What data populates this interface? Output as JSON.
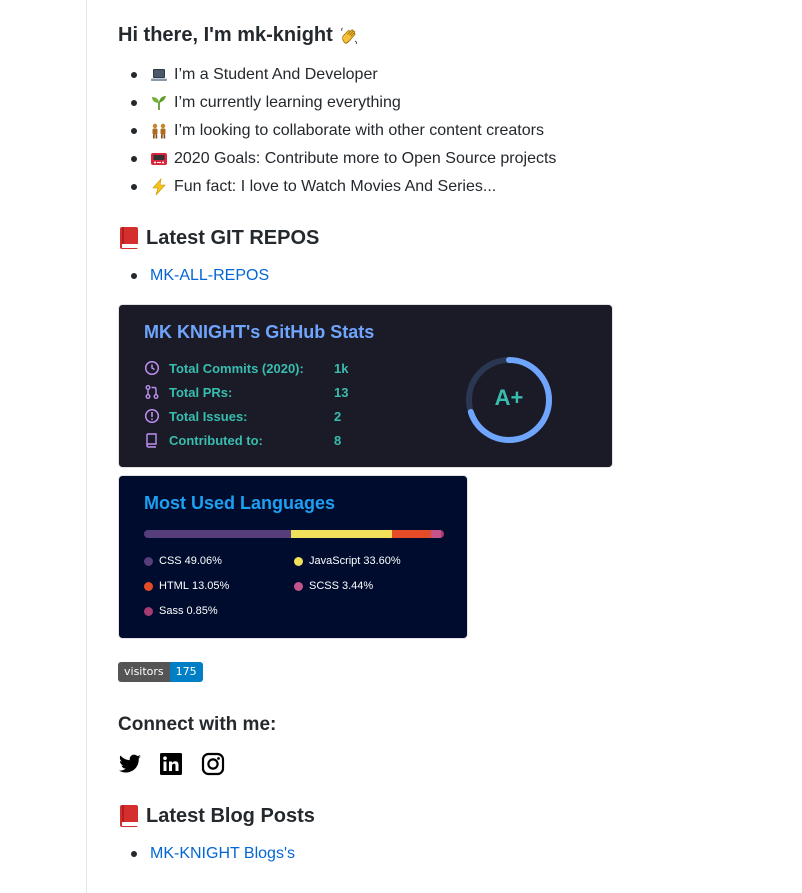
{
  "intro": {
    "heading": "Hi there, I'm mk-knight",
    "wave_icon": "waving-hand-icon",
    "bullets": [
      {
        "icon": "laptop-icon",
        "text": "I’m a Student And Developer"
      },
      {
        "icon": "seedling-icon",
        "text": "I’m currently learning everything"
      },
      {
        "icon": "people-icon",
        "text": "I’m looking to collaborate with other content creators"
      },
      {
        "icon": "game-console-icon",
        "text": "2020 Goals: Contribute more to Open Source projects"
      },
      {
        "icon": "lightning-icon",
        "text": "Fun fact: I love to Watch Movies And Series..."
      }
    ]
  },
  "repos": {
    "heading": "Latest GIT REPOS",
    "icon": "red-book-icon",
    "links": [
      "MK-ALL-REPOS"
    ]
  },
  "stats_card": {
    "title": "MK KNIGHT's GitHub Stats",
    "rows": [
      {
        "icon": "history-icon",
        "label": "Total Commits (2020):",
        "value": "1k"
      },
      {
        "icon": "pull-request-icon",
        "label": "Total PRs:",
        "value": "13"
      },
      {
        "icon": "issue-icon",
        "label": "Total Issues:",
        "value": "2"
      },
      {
        "icon": "repo-icon",
        "label": "Contributed to:",
        "value": "8"
      }
    ],
    "rank": "A+",
    "rank_progress": 0.7,
    "colors": {
      "bg": "#1a1b27",
      "title": "#70a5fd",
      "text": "#38bdae",
      "icon": "#bf91f3"
    }
  },
  "langs_card": {
    "title": "Most Used Languages",
    "languages": [
      {
        "name": "CSS",
        "percent": "49.06%",
        "share": 49.06,
        "color": "#563d7c"
      },
      {
        "name": "JavaScript",
        "percent": "33.60%",
        "share": 33.6,
        "color": "#f1e05a"
      },
      {
        "name": "HTML",
        "percent": "13.05%",
        "share": 13.05,
        "color": "#e34c26"
      },
      {
        "name": "SCSS",
        "percent": "3.44%",
        "share": 3.44,
        "color": "#c6538c"
      },
      {
        "name": "Sass",
        "percent": "0.85%",
        "share": 0.85,
        "color": "#a53b70"
      }
    ]
  },
  "visitors_badge": {
    "label": "visitors",
    "count": "175"
  },
  "connect": {
    "heading": "Connect with me:",
    "icons": [
      "twitter-icon",
      "linkedin-icon",
      "instagram-icon"
    ]
  },
  "blog": {
    "heading": "Latest Blog Posts",
    "icon": "red-book-icon",
    "links": [
      "MK-KNIGHT Blogs's"
    ]
  }
}
